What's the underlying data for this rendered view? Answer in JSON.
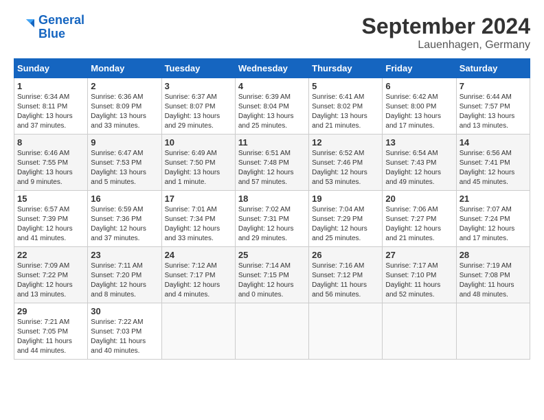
{
  "header": {
    "logo_line1": "General",
    "logo_line2": "Blue",
    "month_title": "September 2024",
    "location": "Lauenhagen, Germany"
  },
  "weekdays": [
    "Sunday",
    "Monday",
    "Tuesday",
    "Wednesday",
    "Thursday",
    "Friday",
    "Saturday"
  ],
  "weeks": [
    [
      {
        "day": "1",
        "info": "Sunrise: 6:34 AM\nSunset: 8:11 PM\nDaylight: 13 hours and 37 minutes."
      },
      {
        "day": "2",
        "info": "Sunrise: 6:36 AM\nSunset: 8:09 PM\nDaylight: 13 hours and 33 minutes."
      },
      {
        "day": "3",
        "info": "Sunrise: 6:37 AM\nSunset: 8:07 PM\nDaylight: 13 hours and 29 minutes."
      },
      {
        "day": "4",
        "info": "Sunrise: 6:39 AM\nSunset: 8:04 PM\nDaylight: 13 hours and 25 minutes."
      },
      {
        "day": "5",
        "info": "Sunrise: 6:41 AM\nSunset: 8:02 PM\nDaylight: 13 hours and 21 minutes."
      },
      {
        "day": "6",
        "info": "Sunrise: 6:42 AM\nSunset: 8:00 PM\nDaylight: 13 hours and 17 minutes."
      },
      {
        "day": "7",
        "info": "Sunrise: 6:44 AM\nSunset: 7:57 PM\nDaylight: 13 hours and 13 minutes."
      }
    ],
    [
      {
        "day": "8",
        "info": "Sunrise: 6:46 AM\nSunset: 7:55 PM\nDaylight: 13 hours and 9 minutes."
      },
      {
        "day": "9",
        "info": "Sunrise: 6:47 AM\nSunset: 7:53 PM\nDaylight: 13 hours and 5 minutes."
      },
      {
        "day": "10",
        "info": "Sunrise: 6:49 AM\nSunset: 7:50 PM\nDaylight: 13 hours and 1 minute."
      },
      {
        "day": "11",
        "info": "Sunrise: 6:51 AM\nSunset: 7:48 PM\nDaylight: 12 hours and 57 minutes."
      },
      {
        "day": "12",
        "info": "Sunrise: 6:52 AM\nSunset: 7:46 PM\nDaylight: 12 hours and 53 minutes."
      },
      {
        "day": "13",
        "info": "Sunrise: 6:54 AM\nSunset: 7:43 PM\nDaylight: 12 hours and 49 minutes."
      },
      {
        "day": "14",
        "info": "Sunrise: 6:56 AM\nSunset: 7:41 PM\nDaylight: 12 hours and 45 minutes."
      }
    ],
    [
      {
        "day": "15",
        "info": "Sunrise: 6:57 AM\nSunset: 7:39 PM\nDaylight: 12 hours and 41 minutes."
      },
      {
        "day": "16",
        "info": "Sunrise: 6:59 AM\nSunset: 7:36 PM\nDaylight: 12 hours and 37 minutes."
      },
      {
        "day": "17",
        "info": "Sunrise: 7:01 AM\nSunset: 7:34 PM\nDaylight: 12 hours and 33 minutes."
      },
      {
        "day": "18",
        "info": "Sunrise: 7:02 AM\nSunset: 7:31 PM\nDaylight: 12 hours and 29 minutes."
      },
      {
        "day": "19",
        "info": "Sunrise: 7:04 AM\nSunset: 7:29 PM\nDaylight: 12 hours and 25 minutes."
      },
      {
        "day": "20",
        "info": "Sunrise: 7:06 AM\nSunset: 7:27 PM\nDaylight: 12 hours and 21 minutes."
      },
      {
        "day": "21",
        "info": "Sunrise: 7:07 AM\nSunset: 7:24 PM\nDaylight: 12 hours and 17 minutes."
      }
    ],
    [
      {
        "day": "22",
        "info": "Sunrise: 7:09 AM\nSunset: 7:22 PM\nDaylight: 12 hours and 13 minutes."
      },
      {
        "day": "23",
        "info": "Sunrise: 7:11 AM\nSunset: 7:20 PM\nDaylight: 12 hours and 8 minutes."
      },
      {
        "day": "24",
        "info": "Sunrise: 7:12 AM\nSunset: 7:17 PM\nDaylight: 12 hours and 4 minutes."
      },
      {
        "day": "25",
        "info": "Sunrise: 7:14 AM\nSunset: 7:15 PM\nDaylight: 12 hours and 0 minutes."
      },
      {
        "day": "26",
        "info": "Sunrise: 7:16 AM\nSunset: 7:12 PM\nDaylight: 11 hours and 56 minutes."
      },
      {
        "day": "27",
        "info": "Sunrise: 7:17 AM\nSunset: 7:10 PM\nDaylight: 11 hours and 52 minutes."
      },
      {
        "day": "28",
        "info": "Sunrise: 7:19 AM\nSunset: 7:08 PM\nDaylight: 11 hours and 48 minutes."
      }
    ],
    [
      {
        "day": "29",
        "info": "Sunrise: 7:21 AM\nSunset: 7:05 PM\nDaylight: 11 hours and 44 minutes."
      },
      {
        "day": "30",
        "info": "Sunrise: 7:22 AM\nSunset: 7:03 PM\nDaylight: 11 hours and 40 minutes."
      },
      {
        "day": "",
        "info": ""
      },
      {
        "day": "",
        "info": ""
      },
      {
        "day": "",
        "info": ""
      },
      {
        "day": "",
        "info": ""
      },
      {
        "day": "",
        "info": ""
      }
    ]
  ]
}
